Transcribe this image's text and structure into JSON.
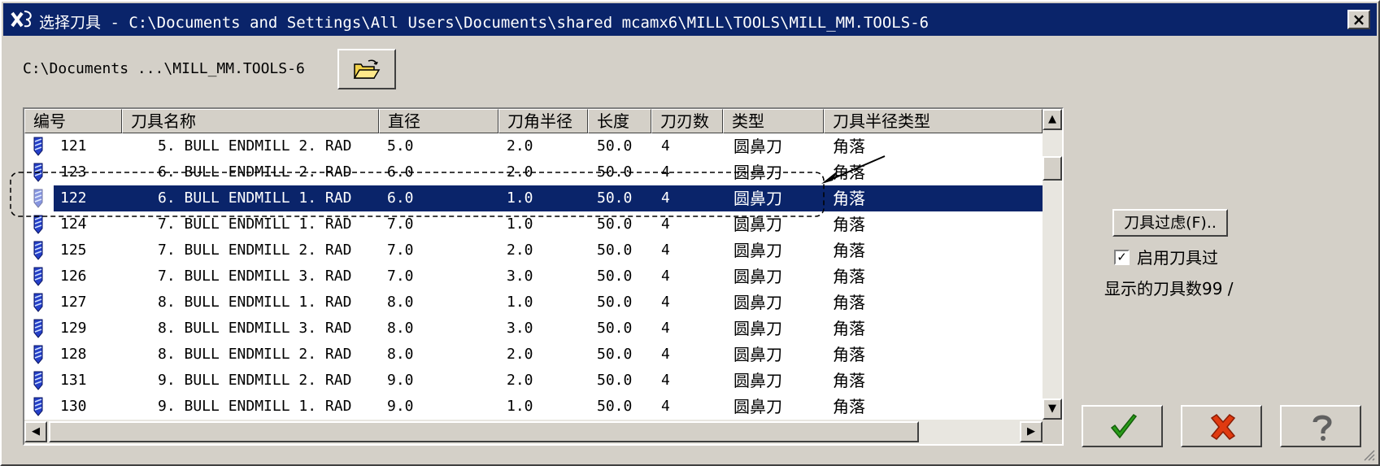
{
  "window": {
    "title": "选择刀具 - C:\\Documents and Settings\\All Users\\Documents\\shared mcamx6\\MILL\\TOOLS\\MILL_MM.TOOLS-6",
    "close_label": "×"
  },
  "path_label": "C:\\Documents ...\\MILL_MM.TOOLS-6",
  "columns": [
    "编号",
    "刀具名称",
    "直径",
    "刀角半径",
    "长度",
    "刀刃数",
    "类型",
    "刀具半径类型"
  ],
  "rows": [
    {
      "num": "121",
      "name": "5. BULL ENDMILL 2. RAD",
      "diameter": "5.0",
      "corner_radius": "2.0",
      "length": "50.0",
      "flutes": "4",
      "type": "圆鼻刀",
      "radius_type": "角落",
      "selected": false
    },
    {
      "num": "123",
      "name": "6. BULL ENDMILL 2. RAD",
      "diameter": "6.0",
      "corner_radius": "2.0",
      "length": "50.0",
      "flutes": "4",
      "type": "圆鼻刀",
      "radius_type": "角落",
      "selected": false
    },
    {
      "num": "122",
      "name": "6. BULL ENDMILL 1. RAD",
      "diameter": "6.0",
      "corner_radius": "1.0",
      "length": "50.0",
      "flutes": "4",
      "type": "圆鼻刀",
      "radius_type": "角落",
      "selected": true
    },
    {
      "num": "124",
      "name": "7. BULL ENDMILL 1. RAD",
      "diameter": "7.0",
      "corner_radius": "1.0",
      "length": "50.0",
      "flutes": "4",
      "type": "圆鼻刀",
      "radius_type": "角落",
      "selected": false
    },
    {
      "num": "125",
      "name": "7. BULL ENDMILL 2. RAD",
      "diameter": "7.0",
      "corner_radius": "2.0",
      "length": "50.0",
      "flutes": "4",
      "type": "圆鼻刀",
      "radius_type": "角落",
      "selected": false
    },
    {
      "num": "126",
      "name": "7. BULL ENDMILL 3. RAD",
      "diameter": "7.0",
      "corner_radius": "3.0",
      "length": "50.0",
      "flutes": "4",
      "type": "圆鼻刀",
      "radius_type": "角落",
      "selected": false
    },
    {
      "num": "127",
      "name": "8. BULL ENDMILL 1. RAD",
      "diameter": "8.0",
      "corner_radius": "1.0",
      "length": "50.0",
      "flutes": "4",
      "type": "圆鼻刀",
      "radius_type": "角落",
      "selected": false
    },
    {
      "num": "129",
      "name": "8. BULL ENDMILL 3. RAD",
      "diameter": "8.0",
      "corner_radius": "3.0",
      "length": "50.0",
      "flutes": "4",
      "type": "圆鼻刀",
      "radius_type": "角落",
      "selected": false
    },
    {
      "num": "128",
      "name": "8. BULL ENDMILL 2. RAD",
      "diameter": "8.0",
      "corner_radius": "2.0",
      "length": "50.0",
      "flutes": "4",
      "type": "圆鼻刀",
      "radius_type": "角落",
      "selected": false
    },
    {
      "num": "131",
      "name": "9. BULL ENDMILL 2. RAD",
      "diameter": "9.0",
      "corner_radius": "2.0",
      "length": "50.0",
      "flutes": "4",
      "type": "圆鼻刀",
      "radius_type": "角落",
      "selected": false
    },
    {
      "num": "130",
      "name": "9. BULL ENDMILL 1. RAD",
      "diameter": "9.0",
      "corner_radius": "1.0",
      "length": "50.0",
      "flutes": "4",
      "type": "圆鼻刀",
      "radius_type": "角落",
      "selected": false
    }
  ],
  "filter_button": "刀具过虑(F)..",
  "enable_filter": {
    "checked": true,
    "mark": "✓",
    "label": "启用刀具过"
  },
  "count_label": "显示的刀具数99 /",
  "scroll": {
    "up": "▲",
    "down": "▼",
    "left": "◀",
    "right": "▶"
  },
  "icons": {
    "app": "mastercam-icon",
    "open": "open-folder-icon",
    "tool": "endmill-tool-icon",
    "ok": "green-check-icon",
    "cancel": "red-x-icon",
    "help": "question-mark-icon"
  },
  "colors": {
    "title_bar": "#0a246a",
    "selection": "#0a246a",
    "dialog_bg": "#d4d0c8",
    "ok_green": "#2a9d1a",
    "cancel_red": "#e03a10"
  }
}
